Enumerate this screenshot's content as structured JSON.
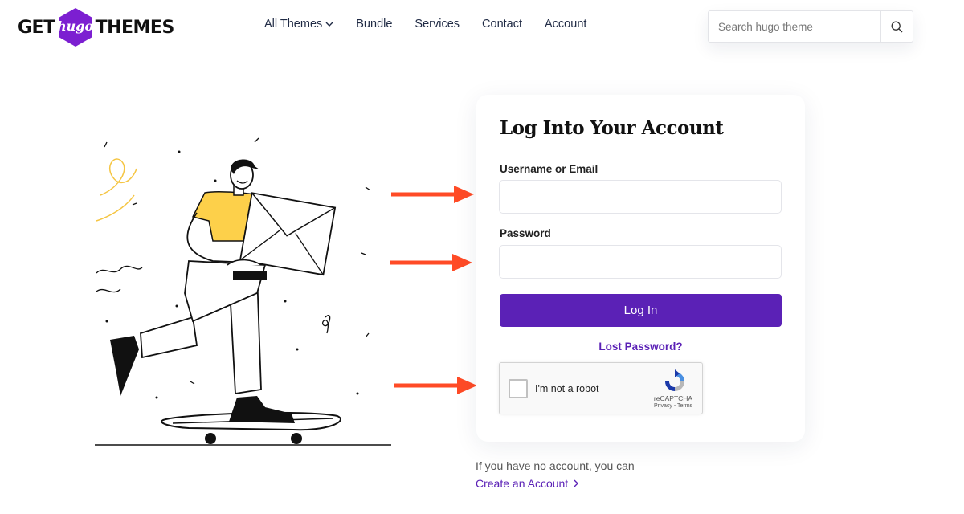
{
  "logo": {
    "left_text": "GET",
    "middle_text": "hugo",
    "right_text": "THEMES",
    "brand_color": "#7c1fd1"
  },
  "nav": {
    "items": [
      {
        "label": "All Themes",
        "has_dropdown": true
      },
      {
        "label": "Bundle"
      },
      {
        "label": "Services"
      },
      {
        "label": "Contact"
      },
      {
        "label": "Account"
      }
    ]
  },
  "search": {
    "placeholder": "Search hugo theme",
    "icon": "search-icon"
  },
  "login": {
    "title": "Log Into Your Account",
    "username_label": "Username or Email",
    "username_value": "",
    "password_label": "Password",
    "password_value": "",
    "submit_label": "Log In",
    "lost_password": "Lost Password?"
  },
  "recaptcha": {
    "label": "I'm not a robot",
    "brand": "reCAPTCHA",
    "terms": "Privacy - Terms",
    "checked": false
  },
  "footer": {
    "no_account_text": "If you have no account, you can",
    "create_link": "Create an Account"
  },
  "colors": {
    "accent": "#5b21b6",
    "arrow": "#ff4b26"
  }
}
